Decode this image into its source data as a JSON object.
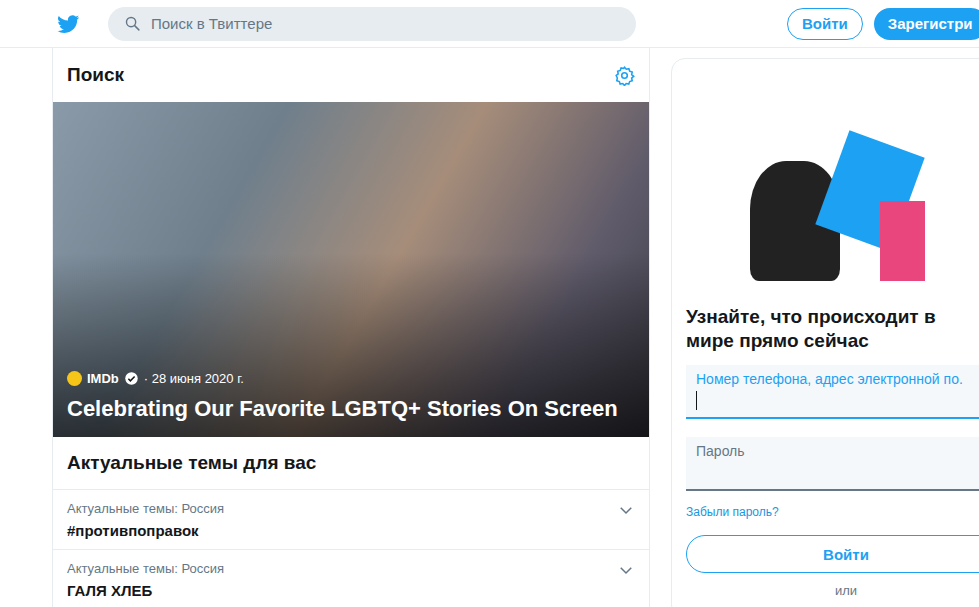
{
  "header": {
    "search_placeholder": "Поиск в Твиттере",
    "login": "Войти",
    "signup": "Зарегистри"
  },
  "main": {
    "title": "Поиск",
    "hero": {
      "source": "IMDb",
      "verified": true,
      "date": "28 июня 2020 г.",
      "separator": "·",
      "title": "Celebrating Our Favorite LGBTQ+ Stories On Screen"
    },
    "trends_title": "Актуальные темы для вас",
    "trends": [
      {
        "context": "Актуальные темы: Россия",
        "name": "#противпоправок"
      },
      {
        "context": "Актуальные темы: Россия",
        "name": "ГАЛЯ ХЛЕБ"
      }
    ]
  },
  "signup_card": {
    "heading": "Узнайте, что происходит в мире прямо сейчас",
    "fields": [
      {
        "label": "Номер телефона, адрес электронной по.",
        "focused": true
      },
      {
        "label": "Пароль",
        "focused": false
      }
    ],
    "forgot": "Забыли пароль?",
    "login": "Войти",
    "or": "или"
  }
}
